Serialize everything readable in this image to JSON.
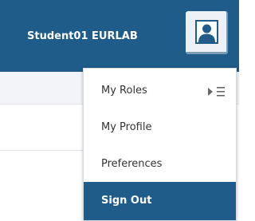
{
  "header": {
    "username": "Student01 EURLAB",
    "avatar_icon": "user-avatar-icon"
  },
  "user_menu": {
    "items": [
      {
        "label": "My Roles",
        "icon": "submenu-list-icon"
      },
      {
        "label": "My Profile"
      },
      {
        "label": "Preferences"
      },
      {
        "label": "Sign Out",
        "highlighted": true
      }
    ]
  },
  "colors": {
    "brand": "#1f5c8a",
    "menu_text": "#333333",
    "highlight_text": "#ffffff"
  }
}
